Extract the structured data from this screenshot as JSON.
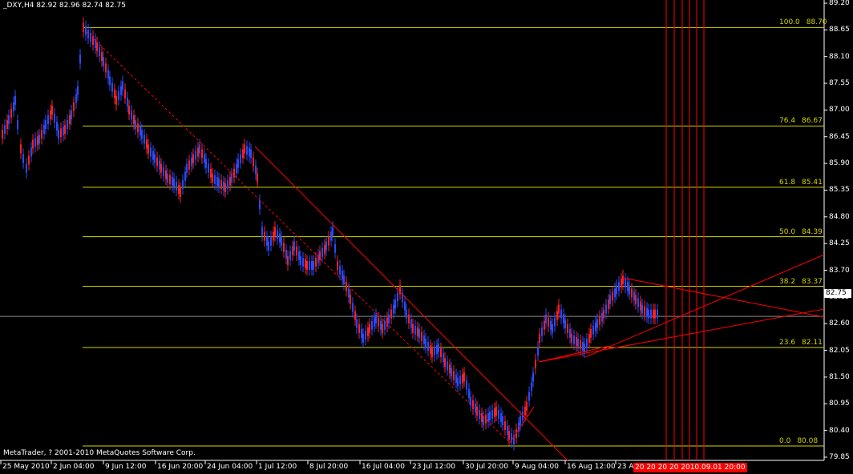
{
  "window": {
    "title": "_DXY,H4  82.92 82.96 82.74 82.75"
  },
  "copyright": "MetaTrader, ? 2001-2010 MetaQuotes Software Corp.",
  "colors": {
    "background": "#000000",
    "bull_candle": "#ff2020",
    "bear_candle": "#2a4bff",
    "fib_line": "#d4d400",
    "trend_line": "#ff0000",
    "grid_text": "#ffffff"
  },
  "price_axis": {
    "labels": [
      "89.20",
      "88.65",
      "88.10",
      "87.55",
      "87.00",
      "86.45",
      "85.90",
      "85.35",
      "84.80",
      "84.25",
      "83.70",
      "83.15",
      "82.60",
      "82.05",
      "81.50",
      "80.95",
      "80.40",
      "79.85"
    ],
    "current_price": "82.75"
  },
  "time_axis": {
    "labels": [
      "25 May 2010",
      "2 Jun 04:00",
      "9 Jun 12:00",
      "16 Jun 20:00",
      "24 Jun 04:00",
      "1 Jul 12:00",
      "8 Jul 20:00",
      "16 Jul 04:00",
      "23 Jul 12:00",
      "30 Jul 20:00",
      "9 Aug 04:00",
      "16 Aug 12:00",
      "23 Au"
    ],
    "red_tag": "20 20 20 20 2010.09.01 20:00"
  },
  "fibonacci": {
    "levels": [
      {
        "pct": "100.0",
        "price": "88.70"
      },
      {
        "pct": "76.4",
        "price": "86.67"
      },
      {
        "pct": "61.8",
        "price": "85.41"
      },
      {
        "pct": "50.0",
        "price": "84.39"
      },
      {
        "pct": "38.2",
        "price": "83.37"
      },
      {
        "pct": "23.6",
        "price": "82.11"
      },
      {
        "pct": "0.0",
        "price": "80.08"
      }
    ]
  }
}
